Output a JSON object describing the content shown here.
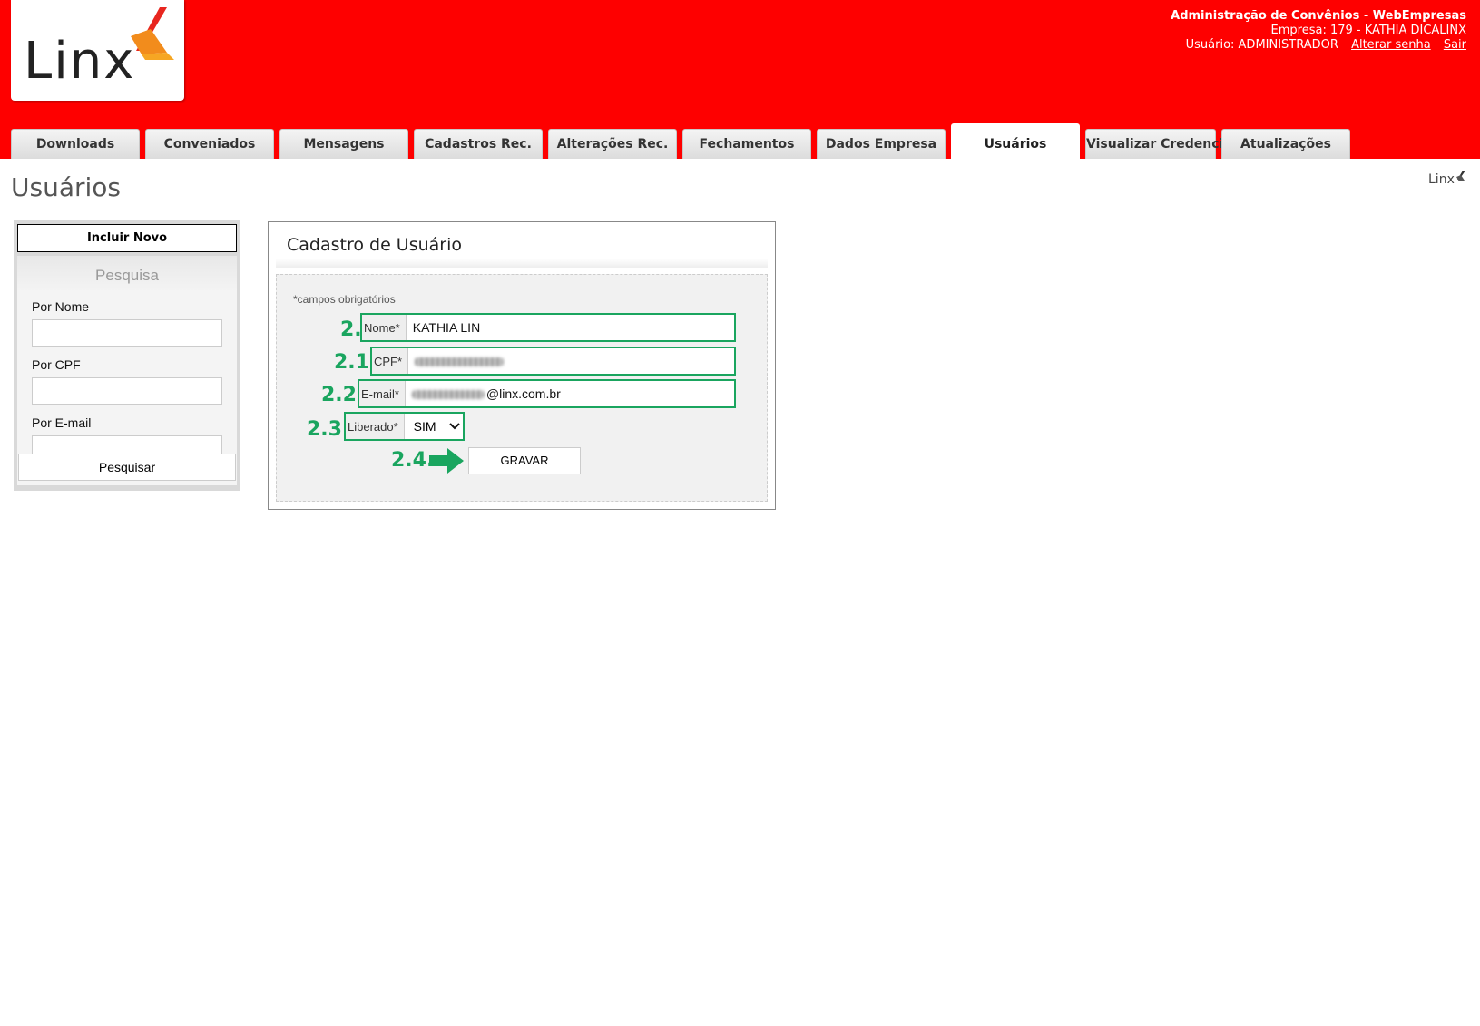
{
  "header": {
    "logo_text": "Linx",
    "system_title": "Administração de Convênios - WebEmpresas",
    "empresa": "Empresa: 179 - KATHIA DICALINX",
    "usuario": "Usuário: ADMINISTRADOR",
    "alterar_senha": "Alterar senha",
    "sair": "Sair",
    "brand_color": "#fe0000"
  },
  "tabs": [
    {
      "label": "Downloads"
    },
    {
      "label": "Conveniados"
    },
    {
      "label": "Mensagens"
    },
    {
      "label": "Cadastros Rec."
    },
    {
      "label": "Alterações Rec."
    },
    {
      "label": "Fechamentos"
    },
    {
      "label": "Dados Empresa"
    },
    {
      "label": "Usuários",
      "active": true
    },
    {
      "label": "Visualizar Credencial"
    },
    {
      "label": "Atualizações"
    }
  ],
  "page": {
    "title": "Usuários",
    "small_logo": "Linx"
  },
  "left_panel": {
    "incluir_novo": "Incluir Novo",
    "search_title": "Pesquisa",
    "por_nome": "Por Nome",
    "por_cpf": "Por CPF",
    "por_email": "Por E-mail",
    "pesquisar": "Pesquisar"
  },
  "form": {
    "title": "Cadastro de Usuário",
    "required_note": "*campos obrigatórios",
    "nome_label": "Nome*",
    "nome_value": "KATHIA LIN",
    "cpf_label": "CPF*",
    "email_label": "E-mail*",
    "email_value_suffix": "@linx.com.br",
    "liberado_label": "Liberado*",
    "liberado_value": "SIM",
    "gravar": "GRAVAR",
    "steps": {
      "nome": "2.",
      "cpf": "2.1.",
      "email": "2.2.",
      "liberado": "2.3.",
      "gravar": "2.4."
    },
    "annotation_color": "#1aa55f"
  }
}
